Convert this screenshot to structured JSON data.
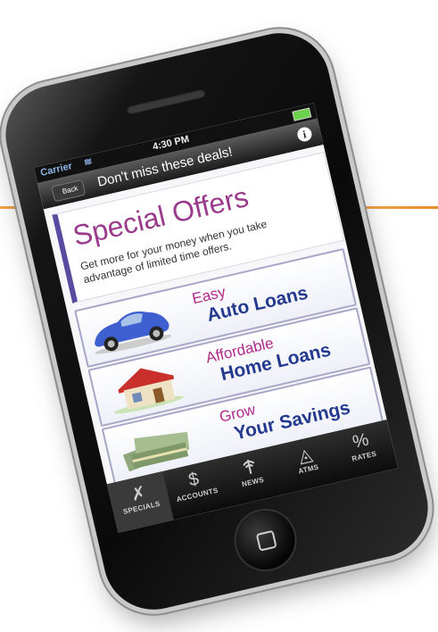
{
  "colors": {
    "accent": "#e8922f",
    "title_purple": "#9a3a8c",
    "offer_blue": "#243a8f",
    "offer_magenta": "#b02a8a"
  },
  "status_bar": {
    "carrier": "Carrier",
    "wifi_icon": "wifi-icon",
    "time": "4:30 PM",
    "battery_icon": "battery-icon"
  },
  "nav": {
    "back_label": "Back",
    "title": "Don't miss these deals!",
    "info_icon": "info-icon"
  },
  "header": {
    "title": "Special Offers",
    "subtitle": "Get more for your money when you take advantage of limited time offers."
  },
  "offers": [
    {
      "line1": "Easy",
      "line2": "Auto Loans",
      "image": "car-image"
    },
    {
      "line1": "Affordable",
      "line2": "Home Loans",
      "image": "house-image"
    },
    {
      "line1": "Grow",
      "line2": "Your Savings",
      "image": "money-image"
    }
  ],
  "tabs": [
    {
      "label": "SPECIALS",
      "icon": "specials-icon",
      "glyph": "✗",
      "selected": true
    },
    {
      "label": "ACCOUNTS",
      "icon": "dollar-icon",
      "glyph": "$",
      "selected": false
    },
    {
      "label": "NEWS",
      "icon": "news-icon",
      "glyph": "📡",
      "selected": false
    },
    {
      "label": "ATMS",
      "icon": "atm-icon",
      "glyph": "◬",
      "selected": false
    },
    {
      "label": "RATES",
      "icon": "percent-icon",
      "glyph": "%",
      "selected": false
    }
  ]
}
